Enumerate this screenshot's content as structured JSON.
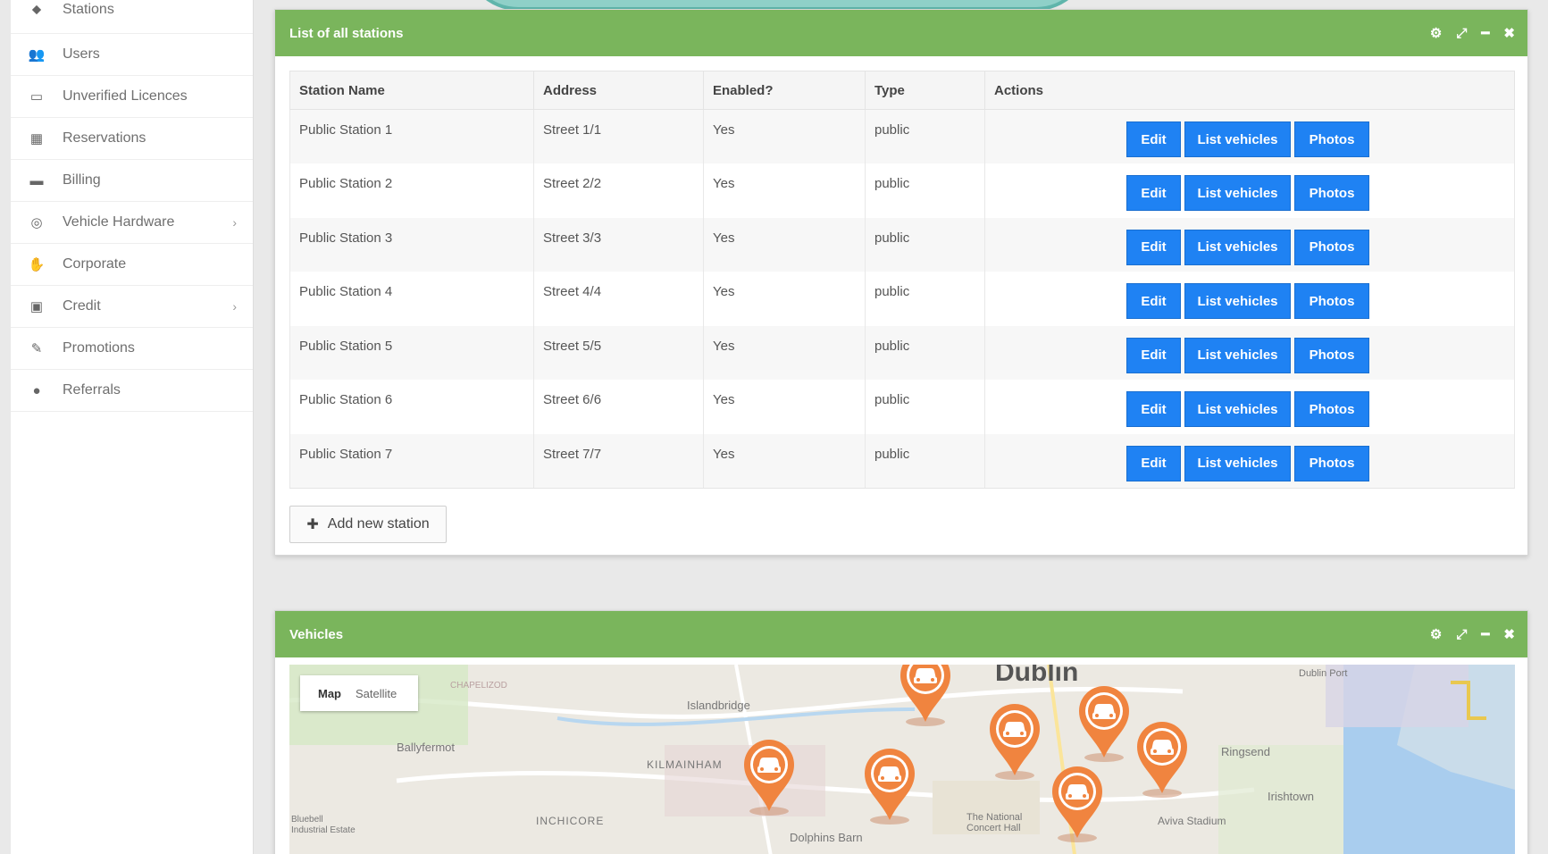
{
  "sidebar": {
    "items": [
      {
        "label": "Stations",
        "icon": "map-marker-icon",
        "chevron": false
      },
      {
        "label": "Users",
        "icon": "users-icon",
        "chevron": false
      },
      {
        "label": "Unverified Licences",
        "icon": "id-card-icon",
        "chevron": false
      },
      {
        "label": "Reservations",
        "icon": "calendar-icon",
        "chevron": false
      },
      {
        "label": "Billing",
        "icon": "credit-card-icon",
        "chevron": false
      },
      {
        "label": "Vehicle Hardware",
        "icon": "lightbulb-icon",
        "chevron": true
      },
      {
        "label": "Corporate",
        "icon": "handshake-icon",
        "chevron": false
      },
      {
        "label": "Credit",
        "icon": "money-icon",
        "chevron": true
      },
      {
        "label": "Promotions",
        "icon": "pen-icon",
        "chevron": false
      },
      {
        "label": "Referrals",
        "icon": "user-icon",
        "chevron": false
      }
    ]
  },
  "stations_panel": {
    "title": "List of all stations",
    "columns": [
      "Station Name",
      "Address",
      "Enabled?",
      "Type",
      "Actions"
    ],
    "rows": [
      {
        "name": "Public Station 1",
        "address": "Street 1/1",
        "enabled": "Yes",
        "type": "public"
      },
      {
        "name": "Public Station 2",
        "address": "Street 2/2",
        "enabled": "Yes",
        "type": "public"
      },
      {
        "name": "Public Station 3",
        "address": "Street 3/3",
        "enabled": "Yes",
        "type": "public"
      },
      {
        "name": "Public Station 4",
        "address": "Street 4/4",
        "enabled": "Yes",
        "type": "public"
      },
      {
        "name": "Public Station 5",
        "address": "Street 5/5",
        "enabled": "Yes",
        "type": "public"
      },
      {
        "name": "Public Station 6",
        "address": "Street 6/6",
        "enabled": "Yes",
        "type": "public"
      },
      {
        "name": "Public Station 7",
        "address": "Street 7/7",
        "enabled": "Yes",
        "type": "public"
      }
    ],
    "actions": {
      "edit": "Edit",
      "list": "List vehicles",
      "photos": "Photos"
    },
    "add_label": "Add new station"
  },
  "vehicles_panel": {
    "title": "Vehicles",
    "map_tabs": {
      "map": "Map",
      "satellite": "Satellite"
    },
    "places": [
      "Dublin",
      "Islandbridge",
      "Ballyfermot",
      "KILMAINHAM",
      "INCHICORE",
      "Ringsend",
      "Irishtown",
      "Aviva Stadium",
      "The National Concert Hall",
      "Dolphins Barn",
      "Dublin Port",
      "CHAPELIZOD",
      "Bluebell",
      "Industrial Estate"
    ]
  },
  "colors": {
    "panel_header": "#7ab55c",
    "button": "#1f82f3",
    "pin": "#f0843f"
  }
}
